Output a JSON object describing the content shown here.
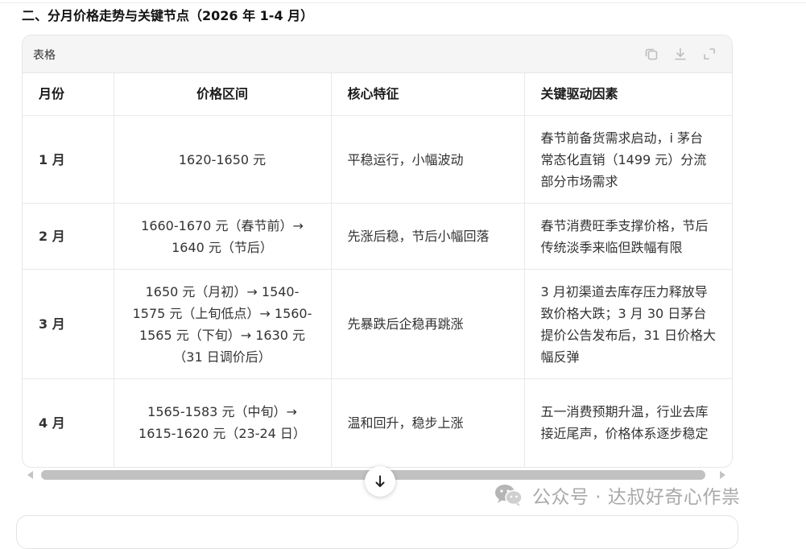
{
  "section": {
    "heading": "二、分月价格走势与关键节点（2026 年 1-4 月）"
  },
  "table": {
    "title": "表格",
    "toolbar": {
      "icons": [
        "copy-icon",
        "download-icon",
        "fullscreen-icon"
      ]
    },
    "columns": [
      "月份",
      "价格区间",
      "核心特征",
      "关键驱动因素"
    ],
    "rows": [
      {
        "month": "1 月",
        "price": "1620-1650 元",
        "feature": "平稳运行，小幅波动",
        "driver": "春节前备货需求启动，i 茅台常态化直销（1499 元）分流部分市场需求"
      },
      {
        "month": "2 月",
        "price": "1660-1670 元（春节前）→ 1640 元（节后）",
        "feature": "先涨后稳，节后小幅回落",
        "driver": "春节消费旺季支撑价格，节后传统淡季来临但跌幅有限"
      },
      {
        "month": "3 月",
        "price": "1650 元（月初）→ 1540-1575 元（上旬低点）→ 1560-1565 元（下旬）→ 1630 元（31 日调价后）",
        "feature": "先暴跌后企稳再跳涨",
        "driver": "3 月初渠道去库存压力释放导致价格大跌；3 月 30 日茅台提价公告发布后，31 日价格大幅反弹"
      },
      {
        "month": "4 月",
        "price": "1565-1583 元（中旬）→ 1615-1620 元（23-24 日）",
        "feature": "温和回升，稳步上涨",
        "driver": "五一消费预期升温，行业去库接近尾声，价格体系逐步稳定"
      }
    ]
  },
  "scroll_button": {
    "icon": "arrow-down-icon"
  },
  "watermark": {
    "text": "公众号 · 达叔好奇心作祟",
    "icon": "wechat-logo-icon"
  }
}
